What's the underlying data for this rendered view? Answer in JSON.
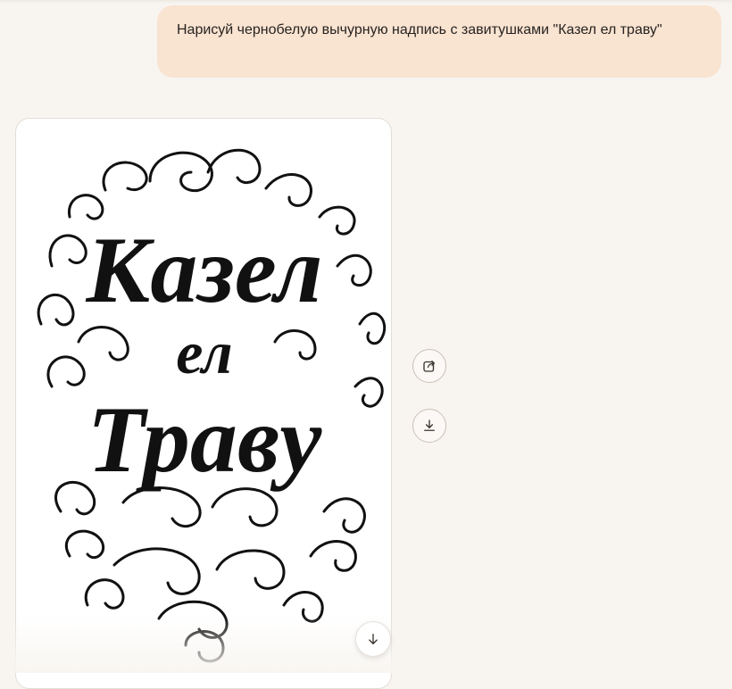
{
  "conversation": {
    "user_message": "Нарисуй чернобелую вычурную надпись с завитушками \"Казел ел траву\""
  },
  "generated_image": {
    "lines": [
      "Казел",
      "ел",
      "Траву"
    ]
  },
  "actions": {
    "share_icon": "share-icon",
    "download_icon": "download-icon",
    "scroll_icon": "arrow-down-icon"
  },
  "colors": {
    "background": "#f8f5f1",
    "user_bubble": "#f9e3d1",
    "ink": "#111111"
  }
}
